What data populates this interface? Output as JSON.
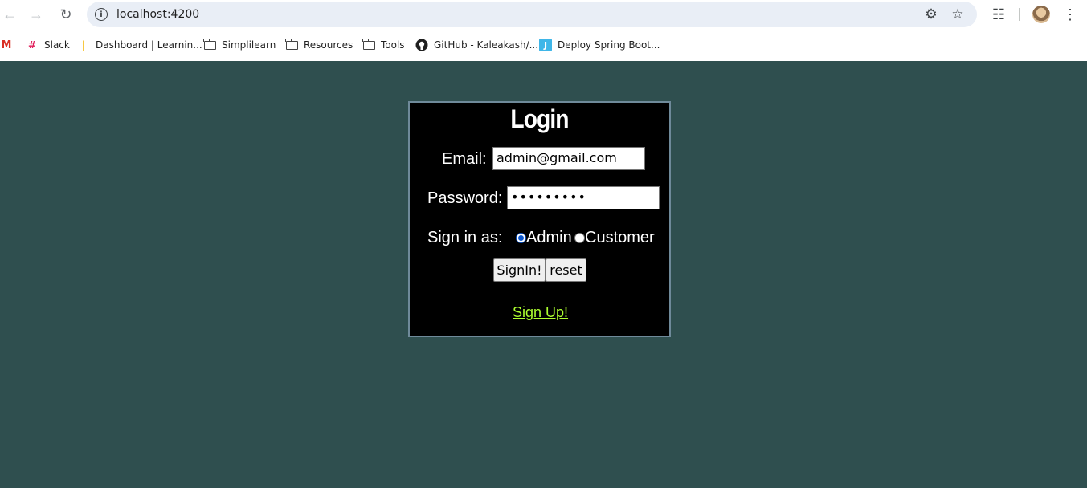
{
  "browser": {
    "url": "localhost:4200",
    "bookmarks": [
      {
        "label": "",
        "icon": "gmail-icon"
      },
      {
        "label": "Slack",
        "icon": "slack-icon"
      },
      {
        "label": "Dashboard | Learnin...",
        "icon": "dashboard-icon"
      },
      {
        "label": "Simplilearn",
        "icon": "folder-icon"
      },
      {
        "label": "Resources",
        "icon": "folder-icon"
      },
      {
        "label": "Tools",
        "icon": "folder-icon"
      },
      {
        "label": "GitHub - Kaleakash/...",
        "icon": "github-icon"
      },
      {
        "label": "Deploy Spring Boot...",
        "icon": "jira-icon"
      }
    ]
  },
  "login": {
    "title": "Login",
    "email_label": "Email:",
    "email_value": "admin@gmail.com",
    "password_label": "Password:",
    "password_value": "•••••••••",
    "role_label": "Sign in as:",
    "role_options": [
      {
        "label": "Admin",
        "checked": true
      },
      {
        "label": "Customer",
        "checked": false
      }
    ],
    "signin_label": "SignIn!",
    "reset_label": "reset",
    "signup_label": "Sign Up!"
  },
  "colors": {
    "page_background": "#2f4f4f",
    "card_background": "#000000",
    "link": "#adff2f"
  }
}
